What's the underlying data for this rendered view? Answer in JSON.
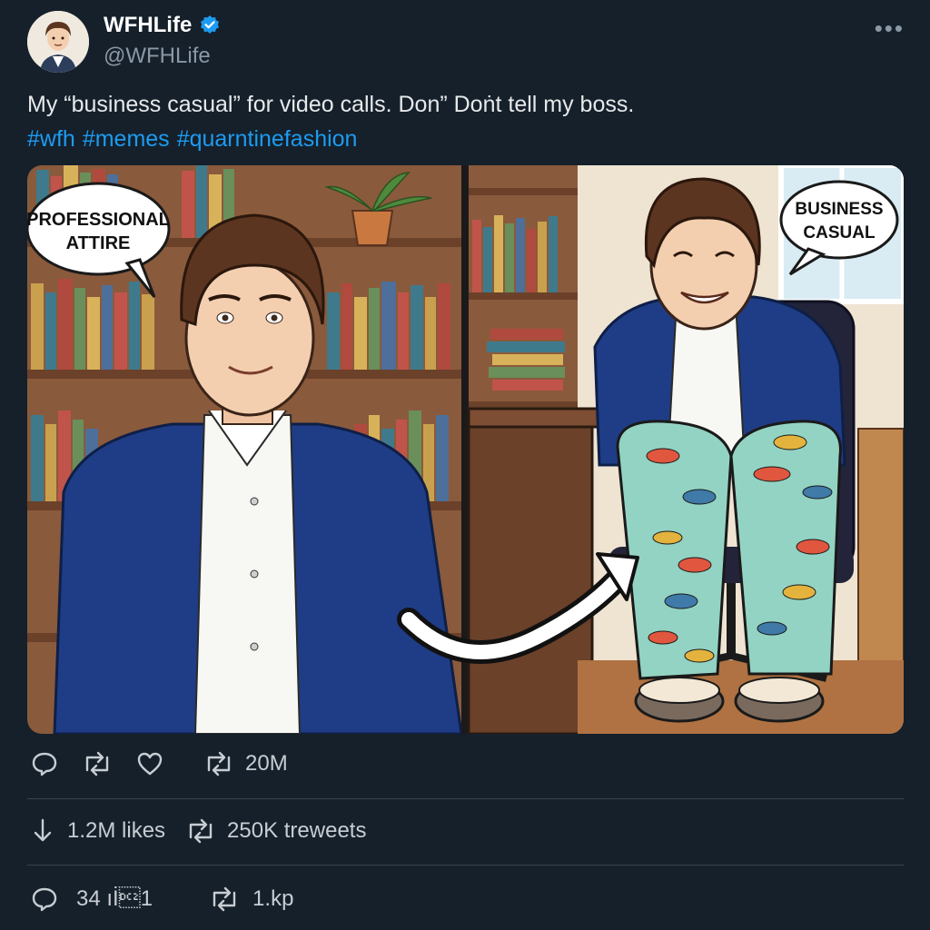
{
  "author": {
    "display_name": "WFHLife",
    "handle": "@WFHLife",
    "verified": true,
    "avatar_icon": "user-avatar"
  },
  "tweet": {
    "text": "My “business casual” for video calls. Don” Doṅt tell my boss.",
    "hashtags": [
      "#wfh",
      "#memes",
      "#quarntinefashion"
    ]
  },
  "media": {
    "left_panel": {
      "speech_bubble": [
        "PROFESSIONAL",
        "ATTIRE"
      ]
    },
    "right_panel": {
      "speech_bubble": [
        "BUSINESS",
        "CASUAL"
      ]
    }
  },
  "actions_row1": {
    "retweet_count": "20M"
  },
  "stats_row": {
    "likes_text": "1.2M likes",
    "retweets_text": "250K treweets"
  },
  "actions_row3": {
    "reply_count": "34 ıİ\u00121",
    "retweet_count": "1.kp"
  },
  "colors": {
    "background": "#15202b",
    "accent": "#1d9bf0",
    "muted": "#8b98a5",
    "divider": "#38444d"
  }
}
